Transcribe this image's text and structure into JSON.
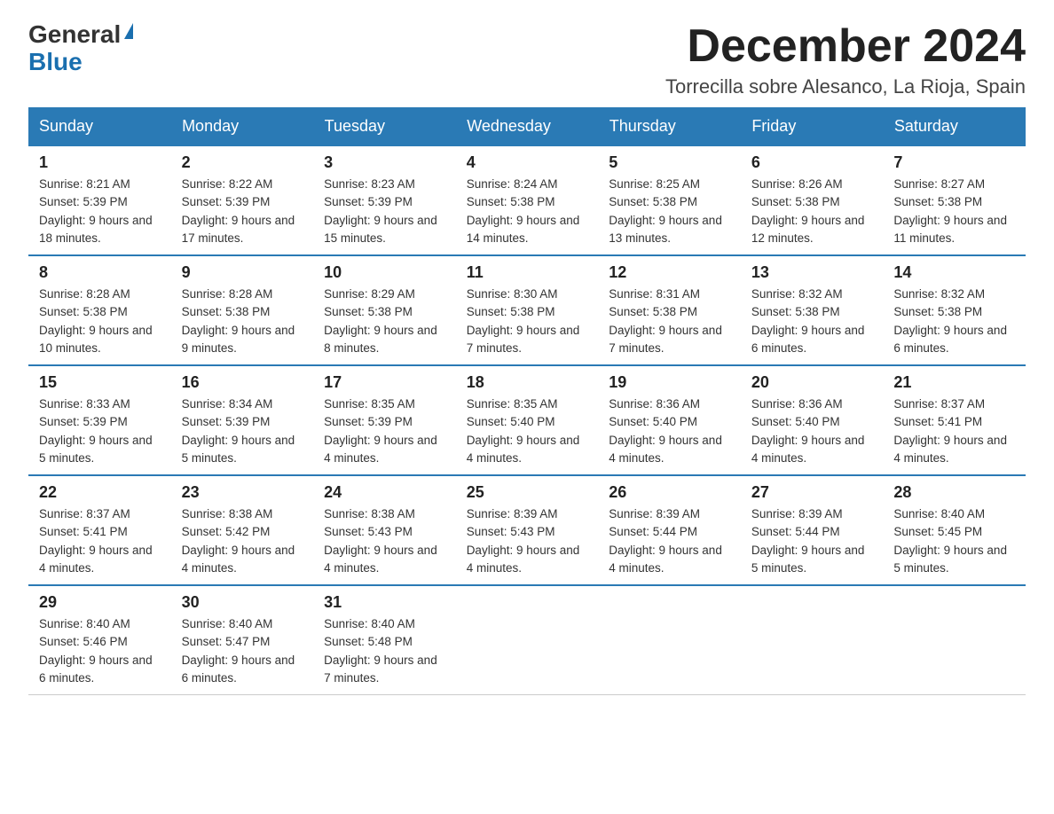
{
  "header": {
    "logo_general": "General",
    "logo_blue": "Blue",
    "month_title": "December 2024",
    "location": "Torrecilla sobre Alesanco, La Rioja, Spain"
  },
  "weekdays": [
    "Sunday",
    "Monday",
    "Tuesday",
    "Wednesday",
    "Thursday",
    "Friday",
    "Saturday"
  ],
  "weeks": [
    [
      {
        "day": "1",
        "sunrise": "8:21 AM",
        "sunset": "5:39 PM",
        "daylight": "9 hours and 18 minutes."
      },
      {
        "day": "2",
        "sunrise": "8:22 AM",
        "sunset": "5:39 PM",
        "daylight": "9 hours and 17 minutes."
      },
      {
        "day": "3",
        "sunrise": "8:23 AM",
        "sunset": "5:39 PM",
        "daylight": "9 hours and 15 minutes."
      },
      {
        "day": "4",
        "sunrise": "8:24 AM",
        "sunset": "5:38 PM",
        "daylight": "9 hours and 14 minutes."
      },
      {
        "day": "5",
        "sunrise": "8:25 AM",
        "sunset": "5:38 PM",
        "daylight": "9 hours and 13 minutes."
      },
      {
        "day": "6",
        "sunrise": "8:26 AM",
        "sunset": "5:38 PM",
        "daylight": "9 hours and 12 minutes."
      },
      {
        "day": "7",
        "sunrise": "8:27 AM",
        "sunset": "5:38 PM",
        "daylight": "9 hours and 11 minutes."
      }
    ],
    [
      {
        "day": "8",
        "sunrise": "8:28 AM",
        "sunset": "5:38 PM",
        "daylight": "9 hours and 10 minutes."
      },
      {
        "day": "9",
        "sunrise": "8:28 AM",
        "sunset": "5:38 PM",
        "daylight": "9 hours and 9 minutes."
      },
      {
        "day": "10",
        "sunrise": "8:29 AM",
        "sunset": "5:38 PM",
        "daylight": "9 hours and 8 minutes."
      },
      {
        "day": "11",
        "sunrise": "8:30 AM",
        "sunset": "5:38 PM",
        "daylight": "9 hours and 7 minutes."
      },
      {
        "day": "12",
        "sunrise": "8:31 AM",
        "sunset": "5:38 PM",
        "daylight": "9 hours and 7 minutes."
      },
      {
        "day": "13",
        "sunrise": "8:32 AM",
        "sunset": "5:38 PM",
        "daylight": "9 hours and 6 minutes."
      },
      {
        "day": "14",
        "sunrise": "8:32 AM",
        "sunset": "5:38 PM",
        "daylight": "9 hours and 6 minutes."
      }
    ],
    [
      {
        "day": "15",
        "sunrise": "8:33 AM",
        "sunset": "5:39 PM",
        "daylight": "9 hours and 5 minutes."
      },
      {
        "day": "16",
        "sunrise": "8:34 AM",
        "sunset": "5:39 PM",
        "daylight": "9 hours and 5 minutes."
      },
      {
        "day": "17",
        "sunrise": "8:35 AM",
        "sunset": "5:39 PM",
        "daylight": "9 hours and 4 minutes."
      },
      {
        "day": "18",
        "sunrise": "8:35 AM",
        "sunset": "5:40 PM",
        "daylight": "9 hours and 4 minutes."
      },
      {
        "day": "19",
        "sunrise": "8:36 AM",
        "sunset": "5:40 PM",
        "daylight": "9 hours and 4 minutes."
      },
      {
        "day": "20",
        "sunrise": "8:36 AM",
        "sunset": "5:40 PM",
        "daylight": "9 hours and 4 minutes."
      },
      {
        "day": "21",
        "sunrise": "8:37 AM",
        "sunset": "5:41 PM",
        "daylight": "9 hours and 4 minutes."
      }
    ],
    [
      {
        "day": "22",
        "sunrise": "8:37 AM",
        "sunset": "5:41 PM",
        "daylight": "9 hours and 4 minutes."
      },
      {
        "day": "23",
        "sunrise": "8:38 AM",
        "sunset": "5:42 PM",
        "daylight": "9 hours and 4 minutes."
      },
      {
        "day": "24",
        "sunrise": "8:38 AM",
        "sunset": "5:43 PM",
        "daylight": "9 hours and 4 minutes."
      },
      {
        "day": "25",
        "sunrise": "8:39 AM",
        "sunset": "5:43 PM",
        "daylight": "9 hours and 4 minutes."
      },
      {
        "day": "26",
        "sunrise": "8:39 AM",
        "sunset": "5:44 PM",
        "daylight": "9 hours and 4 minutes."
      },
      {
        "day": "27",
        "sunrise": "8:39 AM",
        "sunset": "5:44 PM",
        "daylight": "9 hours and 5 minutes."
      },
      {
        "day": "28",
        "sunrise": "8:40 AM",
        "sunset": "5:45 PM",
        "daylight": "9 hours and 5 minutes."
      }
    ],
    [
      {
        "day": "29",
        "sunrise": "8:40 AM",
        "sunset": "5:46 PM",
        "daylight": "9 hours and 6 minutes."
      },
      {
        "day": "30",
        "sunrise": "8:40 AM",
        "sunset": "5:47 PM",
        "daylight": "9 hours and 6 minutes."
      },
      {
        "day": "31",
        "sunrise": "8:40 AM",
        "sunset": "5:48 PM",
        "daylight": "9 hours and 7 minutes."
      },
      null,
      null,
      null,
      null
    ]
  ]
}
